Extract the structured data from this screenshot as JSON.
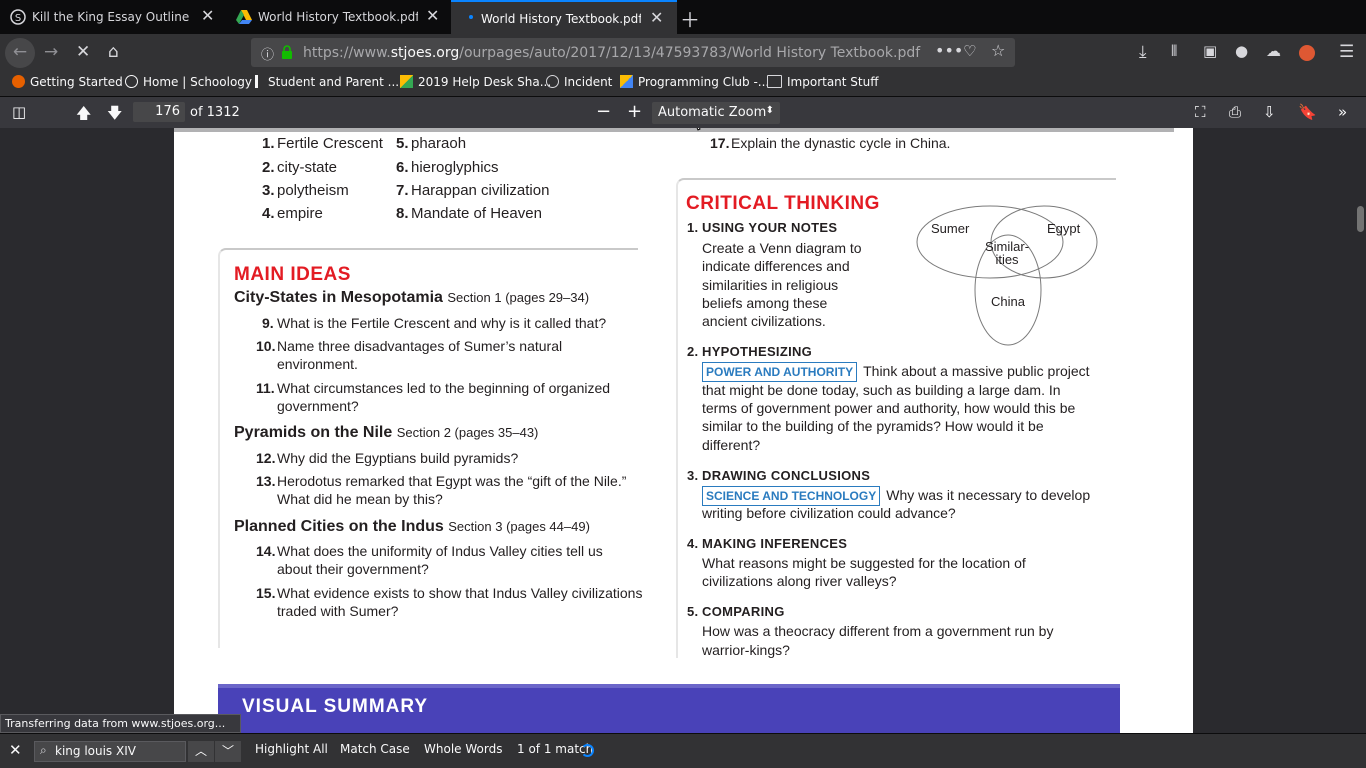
{
  "tabs": [
    {
      "title": "Kill the King Essay Outline | Sch",
      "icon": "schoology-icon",
      "active": false
    },
    {
      "title": "World History Textbook.pdf - Fr",
      "icon": "google-drive-icon",
      "active": false
    },
    {
      "title": "World History Textbook.pdf",
      "icon": "pdf-icon",
      "active": true
    }
  ],
  "url": {
    "prefix": "https://www.",
    "host": "stjoes.org",
    "path": "/ourpages/auto/2017/12/13/47593783/World History Textbook.pdf"
  },
  "bookmarks": [
    "Getting Started",
    "Home | Schoology",
    "Student and Parent ...",
    "2019 Help Desk Sha...",
    "Incident",
    "Programming Club -...",
    "Important Stuff"
  ],
  "pdf": {
    "page": "176",
    "of": "of 1312",
    "zoom": "Automatic Zoom"
  },
  "doc": {
    "terms": [
      {
        "n": "1.",
        "t": "Fertile Crescent"
      },
      {
        "n": "2.",
        "t": "city-state"
      },
      {
        "n": "3.",
        "t": "polytheism"
      },
      {
        "n": "4.",
        "t": "empire"
      },
      {
        "n": "5.",
        "t": "pharaoh"
      },
      {
        "n": "6.",
        "t": "hieroglyphics"
      },
      {
        "n": "7.",
        "t": "Harappan civilization"
      },
      {
        "n": "8.",
        "t": "Mandate of Heaven"
      }
    ],
    "q17": {
      "n": "17.",
      "t": "Explain the dynastic cycle in China."
    },
    "main_ideas": "MAIN IDEAS",
    "sections": [
      {
        "title": "City-States in Mesopotamia",
        "ref": "Section 1 (pages 29–34)"
      },
      {
        "title": "Pyramids on the Nile",
        "ref": "Section 2 (pages 35–43)"
      },
      {
        "title": "Planned Cities on the Indus",
        "ref": "Section 3 (pages 44–49)"
      }
    ],
    "questions": [
      {
        "n": "9.",
        "l1": "What is the Fertile Crescent and why is it called that?",
        "l2": ""
      },
      {
        "n": "10.",
        "l1": "Name three disadvantages of Sumer’s natural",
        "l2": "environment."
      },
      {
        "n": "11.",
        "l1": "What circumstances led to the beginning of organized",
        "l2": "government?"
      },
      {
        "n": "12.",
        "l1": "Why did the Egyptians build pyramids?",
        "l2": ""
      },
      {
        "n": "13.",
        "l1": "Herodotus remarked that Egypt was the “gift of the Nile.”",
        "l2": "What did he mean by this?"
      },
      {
        "n": "14.",
        "l1": "What does the uniformity of Indus Valley cities tell us",
        "l2": "about their government?"
      },
      {
        "n": "15.",
        "l1": "What evidence exists to show that Indus Valley civilizations",
        "l2": "traded with Sumer?"
      }
    ],
    "critical": "CRITICAL THINKING",
    "ct": [
      {
        "n": "1.",
        "h": "USING YOUR NOTES",
        "tag": "",
        "lines": [
          "Create a Venn diagram to",
          "indicate differences and",
          "similarities in religious",
          "beliefs among these",
          "ancient civilizations."
        ]
      },
      {
        "n": "2.",
        "h": "HYPOTHESIZING",
        "tag": "POWER AND AUTHORITY",
        "first": "Think about a massive public project",
        "lines": [
          "that might be done today, such as building a large dam. In",
          "terms of government power and authority, how would this be",
          "similar to the building of the pyramids? How would it be",
          "different?"
        ]
      },
      {
        "n": "3.",
        "h": "DRAWING CONCLUSIONS",
        "tag": "SCIENCE AND TECHNOLOGY",
        "first": "Why was it necessary to develop",
        "lines": [
          "writing before civilization could advance?"
        ]
      },
      {
        "n": "4.",
        "h": "MAKING INFERENCES",
        "tag": "",
        "lines": [
          "What reasons might be suggested for the location of",
          "civilizations along river valleys?"
        ]
      },
      {
        "n": "5.",
        "h": "COMPARING",
        "tag": "",
        "lines": [
          "How was a theocracy different from a government run by",
          "warrior-kings?"
        ]
      }
    ],
    "venn": {
      "a": "Sumer",
      "b": "Egypt",
      "c": "China",
      "mid1": "Similar-",
      "mid2": "ities"
    },
    "visual_summary": "VISUAL SUMMARY"
  },
  "status": "Transferring data from www.stjoes.org...",
  "find": {
    "query": "king louis XIV",
    "highlight": "Highlight All",
    "match_case": "Match Case",
    "whole_words": "Whole Words",
    "result": "1 of 1 match"
  }
}
